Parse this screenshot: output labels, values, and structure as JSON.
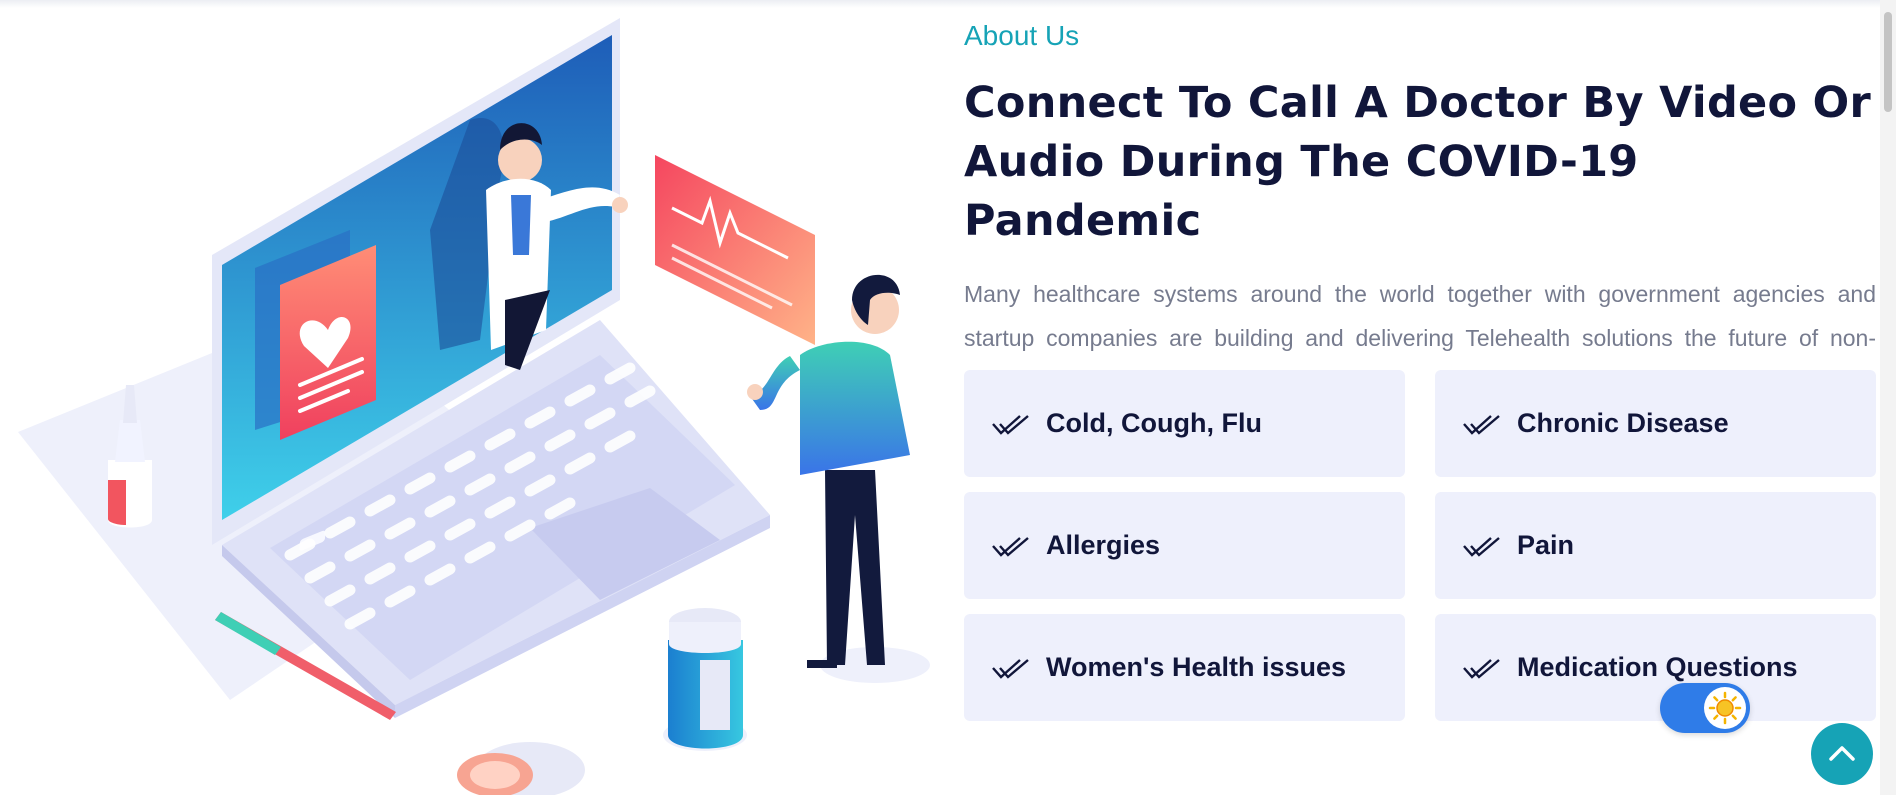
{
  "about": {
    "eyebrow": "About Us",
    "headline": "Connect To Call A Doctor By Video Or Audio During The COVID-19 Pandemic",
    "description": "Many healthcare systems around the world together with government agencies and startup companies are building and delivering Telehealth solutions the future of non-emergency and routine healthcare delivery"
  },
  "features": [
    {
      "label": "Cold, Cough, Flu",
      "icon": "check-icon"
    },
    {
      "label": "Chronic Disease",
      "icon": "check-icon"
    },
    {
      "label": "Allergies",
      "icon": "check-icon"
    },
    {
      "label": "Pain",
      "icon": "check-icon"
    },
    {
      "label": "Women's Health issues",
      "icon": "check-icon"
    },
    {
      "label": "Medication Questions",
      "icon": "check-icon"
    }
  ],
  "controls": {
    "theme_toggle": {
      "state": "light",
      "icon": "sun-icon"
    },
    "back_to_top": {
      "icon": "chevron-up-icon"
    }
  },
  "colors": {
    "accent": "#16a3b6",
    "heading": "#11163a",
    "body_text": "#767b8e",
    "card_background": "#eef0fc",
    "toggle": "#2f7ce8"
  }
}
